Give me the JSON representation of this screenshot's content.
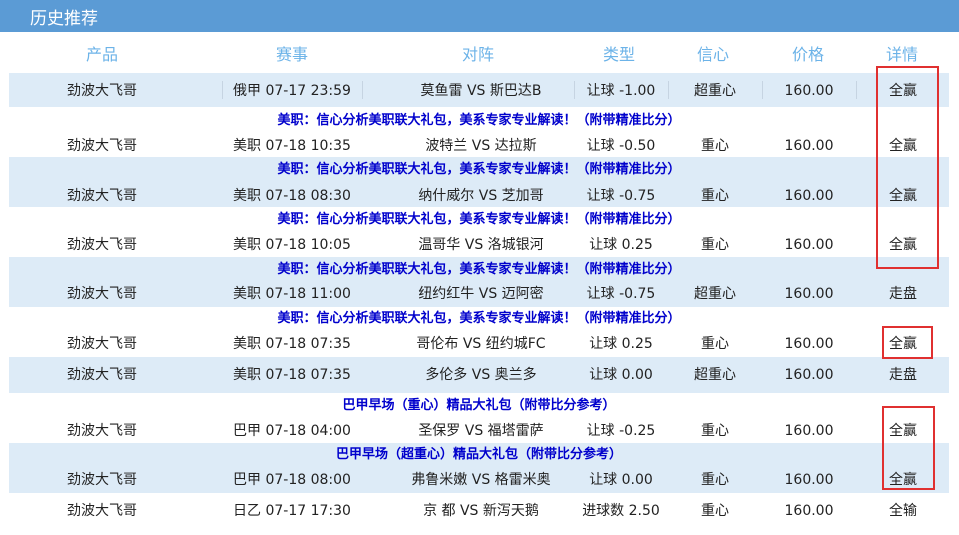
{
  "title": "历史推荐",
  "headers": [
    "产品",
    "赛事",
    "对阵",
    "类型",
    "信心",
    "价格",
    "详情"
  ],
  "promos": {
    "us_league": "美职：信心分析美职联大礼包，美系专家专业解读！（附带精准比分）",
    "brazil_a": "巴甲早场（重心）精品大礼包（附带比分参考）",
    "brazil_b": "巴甲早场（超重心）精品大礼包（附带比分参考）"
  },
  "rows": [
    {
      "product": "劲波大飞哥",
      "match": "俄甲 07-17 23:59",
      "teams": "莫鱼雷 VS 斯巴达B",
      "type": "让球 -1.00",
      "confidence": "超重心",
      "price": "160.00",
      "result": "全赢"
    },
    {
      "product": "劲波大飞哥",
      "match": "美职 07-18 10:35",
      "teams": "波特兰 VS 达拉斯",
      "type": "让球 -0.50",
      "confidence": "重心",
      "price": "160.00",
      "result": "全赢"
    },
    {
      "product": "劲波大飞哥",
      "match": "美职 07-18 08:30",
      "teams": "纳什威尔 VS 芝加哥",
      "type": "让球 -0.75",
      "confidence": "重心",
      "price": "160.00",
      "result": "全赢"
    },
    {
      "product": "劲波大飞哥",
      "match": "美职 07-18 10:05",
      "teams": "温哥华 VS 洛城银河",
      "type": "让球 0.25",
      "confidence": "重心",
      "price": "160.00",
      "result": "全赢"
    },
    {
      "product": "劲波大飞哥",
      "match": "美职 07-18 11:00",
      "teams": "纽约红牛 VS 迈阿密",
      "type": "让球 -0.75",
      "confidence": "超重心",
      "price": "160.00",
      "result": "走盘"
    },
    {
      "product": "劲波大飞哥",
      "match": "美职 07-18 07:35",
      "teams": "哥伦布 VS 纽约城FC",
      "type": "让球 0.25",
      "confidence": "重心",
      "price": "160.00",
      "result": "全赢"
    },
    {
      "product": "劲波大飞哥",
      "match": "美职 07-18 07:35",
      "teams": "多伦多 VS 奥兰多",
      "type": "让球 0.00",
      "confidence": "超重心",
      "price": "160.00",
      "result": "走盘"
    },
    {
      "product": "劲波大飞哥",
      "match": "巴甲 07-18 04:00",
      "teams": "圣保罗 VS 福塔雷萨",
      "type": "让球 -0.25",
      "confidence": "重心",
      "price": "160.00",
      "result": "全赢"
    },
    {
      "product": "劲波大飞哥",
      "match": "巴甲 07-18 08:00",
      "teams": "弗鲁米嫩 VS 格雷米奥",
      "type": "让球 0.00",
      "confidence": "重心",
      "price": "160.00",
      "result": "全赢"
    },
    {
      "product": "劲波大飞哥",
      "match": "日乙 07-17 17:30",
      "teams": "京 都 VS 新泻天鹅",
      "type": "进球数 2.50",
      "confidence": "重心",
      "price": "160.00",
      "result": "全输"
    }
  ]
}
